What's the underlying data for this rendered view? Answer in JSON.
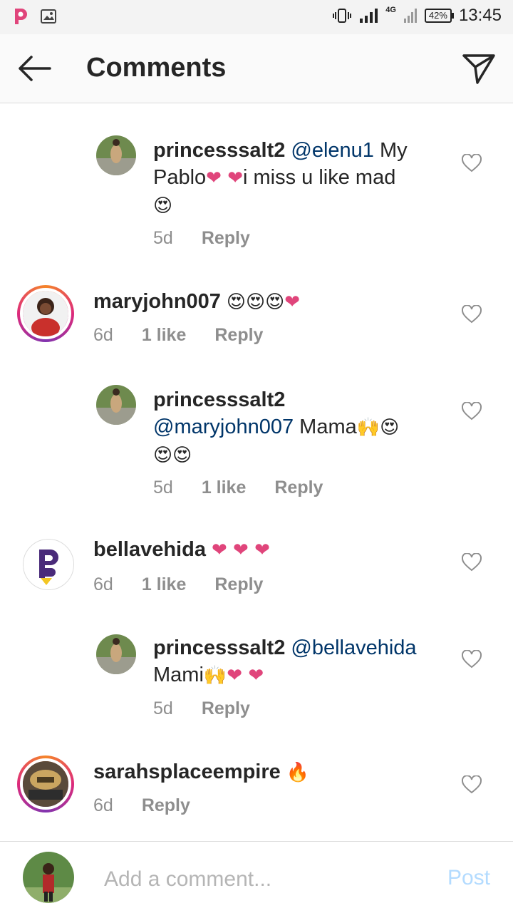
{
  "status_bar": {
    "network": "4G",
    "battery": "42%",
    "time": "13:45"
  },
  "header": {
    "title": "Comments"
  },
  "colors": {
    "mention": "#003569",
    "heart": "#e0457b",
    "post_disabled": "#b3dbff"
  },
  "comments": [
    {
      "user": "princesssalt2",
      "mention": "@elenu1",
      "text_a": " My Pablo",
      "hearts": "❤ ❤",
      "text_b": "i miss u like mad",
      "emojis": "😍",
      "time": "5d",
      "reply": "Reply"
    },
    {
      "user": "maryjohn007",
      "emojis": "😍😍😍",
      "hearts": "❤",
      "time": "6d",
      "likes": "1 like",
      "reply": "Reply"
    },
    {
      "user": "princesssalt2",
      "mention": "@maryjohn007",
      "text_a": " Mama",
      "emojis_a": "🙌😍",
      "emojis_b": "😍😍",
      "time": "5d",
      "likes": "1 like",
      "reply": "Reply"
    },
    {
      "user": "bellavehida",
      "hearts": "❤ ❤ ❤",
      "time": "6d",
      "likes": "1 like",
      "reply": "Reply"
    },
    {
      "user": "princesssalt2",
      "mention": "@bellavehida",
      "text_a": "Mami",
      "emojis": "🙌",
      "hearts": "❤ ❤",
      "time": "5d",
      "reply": "Reply"
    },
    {
      "user": "sarahsplaceempire",
      "emojis": "🔥",
      "time": "6d",
      "reply": "Reply"
    }
  ],
  "composer": {
    "placeholder": "Add a comment...",
    "post_label": "Post"
  }
}
